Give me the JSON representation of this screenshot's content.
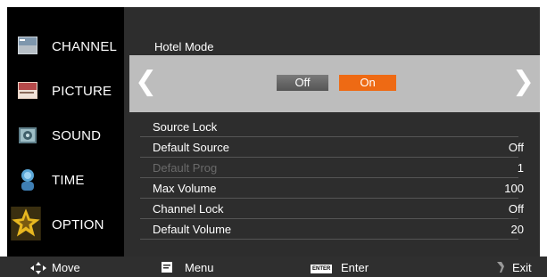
{
  "sidebar": {
    "items": [
      {
        "label": "CHANNEL",
        "icon": "channel-icon"
      },
      {
        "label": "PICTURE",
        "icon": "picture-icon"
      },
      {
        "label": "SOUND",
        "icon": "sound-icon"
      },
      {
        "label": "TIME",
        "icon": "time-icon"
      },
      {
        "label": "OPTION",
        "icon": "option-star-icon",
        "selected": true
      }
    ]
  },
  "panel": {
    "title": "Hotel Mode",
    "hotel_mode": {
      "options": [
        "Off",
        "On"
      ],
      "selected": "On"
    },
    "rows": [
      {
        "label": "Source Lock",
        "value": ""
      },
      {
        "label": "Default Source",
        "value": "Off"
      },
      {
        "label": "Default Prog",
        "value": "1",
        "disabled": true
      },
      {
        "label": "Max Volume",
        "value": "100"
      },
      {
        "label": "Channel Lock",
        "value": "Off"
      },
      {
        "label": "Default Volume",
        "value": "20"
      }
    ]
  },
  "footer": {
    "move": "Move",
    "menu": "Menu",
    "enter_key": "ENTER",
    "enter": "Enter",
    "exit": "Exit"
  },
  "colors": {
    "accent_on": "#ee6a14",
    "panel_bg": "#2d2d2d",
    "band_bg": "#bdbdbd"
  }
}
